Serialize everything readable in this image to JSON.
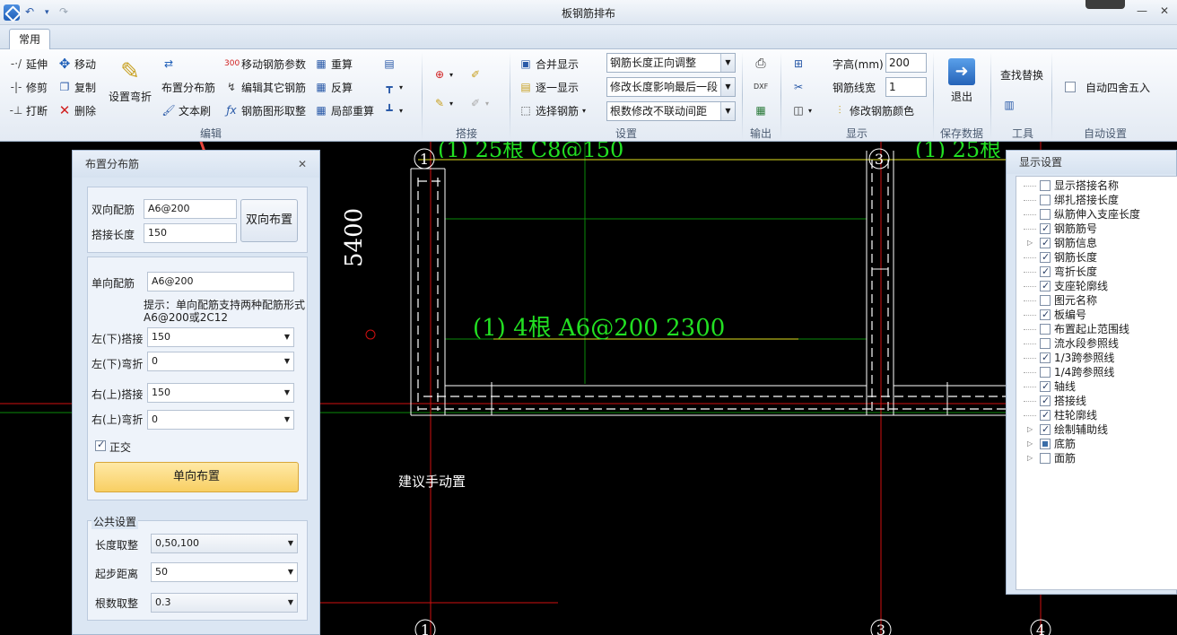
{
  "window": {
    "title": "板钢筋排布",
    "minimize_glyph": "—",
    "close_glyph": "✕"
  },
  "tabs": [
    {
      "label": "常用",
      "active": true
    }
  ],
  "ribbon": {
    "edit": {
      "group_label": "编辑",
      "items": {
        "extend": "延伸",
        "move": "移动",
        "trim": "修剪",
        "copy": "复制",
        "break": "打断",
        "delete": "删除",
        "set_bend": "设置弯折",
        "place_dist": "布置分布筋",
        "text_brush": "文本刷",
        "move_params": "移动钢筋参数",
        "edit_other": "编辑其它钢筋",
        "shape_pick": "钢筋图形取整",
        "recalc": "重算",
        "reverse": "反算",
        "partial_recalc": "局部重算"
      }
    },
    "lap": {
      "group_label": "搭接"
    },
    "settings": {
      "group_label": "设置",
      "merge_display": "合并显示",
      "show_one_by_one": "逐一显示",
      "select_rebar": "选择钢筋",
      "combo1": "钢筋长度正向调整",
      "combo2": "修改长度影响最后一段",
      "combo3": "根数修改不联动间距"
    },
    "output": {
      "group_label": "输出"
    },
    "display": {
      "group_label": "显示",
      "font_height_label": "字高(mm)",
      "font_height_value": "200",
      "line_width_label": "钢筋线宽",
      "line_width_value": "1",
      "modify_color": "修改钢筋颜色"
    },
    "save": {
      "group_label": "保存数据",
      "exit": "退出"
    },
    "tools": {
      "group_label": "工具",
      "find_replace": "查找替换"
    },
    "auto": {
      "group_label": "自动设置",
      "round_label": "自动四舍五入",
      "round_checked": false
    }
  },
  "canvas": {
    "dimension": "5400",
    "rebar_label": "(1) 4根 A6@200   2300",
    "hint": "建议手动置",
    "top_label_left": "(1) 25根 C8@150",
    "top_label_right": "(1) 25根",
    "axis_tags": [
      "1",
      "3",
      "1",
      "3",
      "4"
    ]
  },
  "dialog": {
    "title": "布置分布筋",
    "close_glyph": "✕",
    "bi": {
      "rebar_label": "双向配筋",
      "rebar_value": "A6@200",
      "lap_label": "搭接长度",
      "lap_value": "150",
      "button": "双向布置"
    },
    "uni": {
      "rebar_label": "单向配筋",
      "rebar_value": "A6@200",
      "hint_line1": "提示：单向配筋支持两种配筋形式",
      "hint_line2": "A6@200或2C12",
      "left_lap_label": "左(下)搭接",
      "left_lap_value": "150",
      "left_bend_label": "左(下)弯折",
      "left_bend_value": "0",
      "right_lap_label": "右(上)搭接",
      "right_lap_value": "150",
      "right_bend_label": "右(上)弯折",
      "right_bend_value": "0",
      "orthogonal_label": "正交",
      "orthogonal_checked": true,
      "button": "单向布置"
    },
    "common": {
      "group_label": "公共设置",
      "length_round_label": "长度取整",
      "length_round_value": "0,50,100",
      "start_dist_label": "起步距离",
      "start_dist_value": "50",
      "count_round_label": "根数取整",
      "count_round_value": "0.3"
    }
  },
  "display_panel": {
    "title": "显示设置",
    "items": [
      {
        "label": "显示搭接名称",
        "checked": false,
        "expandable": false
      },
      {
        "label": "绑扎搭接长度",
        "checked": false,
        "expandable": false
      },
      {
        "label": "纵筋伸入支座长度",
        "checked": false,
        "expandable": false
      },
      {
        "label": "钢筋筋号",
        "checked": true,
        "expandable": false
      },
      {
        "label": "钢筋信息",
        "checked": true,
        "expandable": true
      },
      {
        "label": "钢筋长度",
        "checked": true,
        "expandable": false
      },
      {
        "label": "弯折长度",
        "checked": true,
        "expandable": false
      },
      {
        "label": "支座轮廓线",
        "checked": true,
        "expandable": false
      },
      {
        "label": "图元名称",
        "checked": false,
        "expandable": false
      },
      {
        "label": "板编号",
        "checked": true,
        "expandable": false
      },
      {
        "label": "布置起止范围线",
        "checked": false,
        "expandable": false
      },
      {
        "label": "流水段参照线",
        "checked": false,
        "expandable": false
      },
      {
        "label": "1/3跨参照线",
        "checked": true,
        "expandable": false
      },
      {
        "label": "1/4跨参照线",
        "checked": false,
        "expandable": false
      },
      {
        "label": "轴线",
        "checked": true,
        "expandable": false
      },
      {
        "label": "搭接线",
        "checked": true,
        "expandable": false
      },
      {
        "label": "柱轮廓线",
        "checked": true,
        "expandable": false
      },
      {
        "label": "绘制辅助线",
        "checked": true,
        "expandable": true
      },
      {
        "label": "底筋",
        "checked": "partial",
        "expandable": true
      },
      {
        "label": "面筋",
        "checked": false,
        "expandable": true
      }
    ]
  },
  "colors": {
    "canvas_bg": "#000000",
    "cad_green": "#22e022",
    "axis_red": "#d01010",
    "grid_green": "#0a8a0a",
    "annotation_arrow": "#e8453c",
    "accent_button": "#f8cf63"
  }
}
